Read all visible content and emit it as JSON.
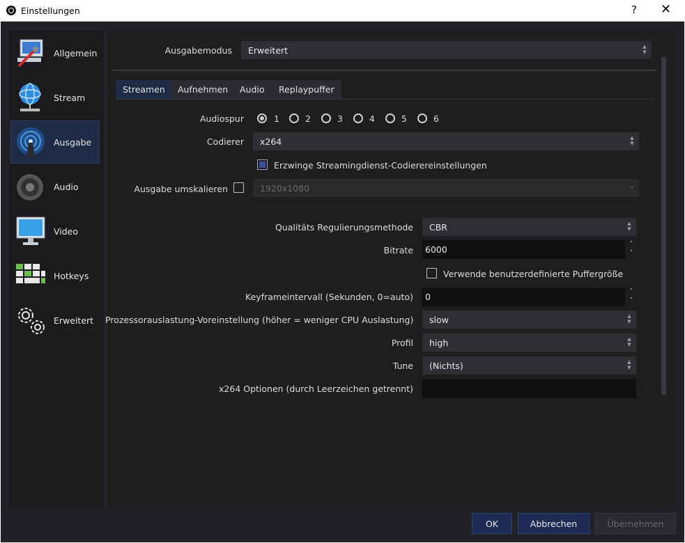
{
  "window": {
    "title": "Einstellungen",
    "help": "?",
    "close": "✕"
  },
  "sidebar": {
    "items": [
      {
        "label": "Allgemein"
      },
      {
        "label": "Stream"
      },
      {
        "label": "Ausgabe"
      },
      {
        "label": "Audio"
      },
      {
        "label": "Video"
      },
      {
        "label": "Hotkeys"
      },
      {
        "label": "Erweitert"
      }
    ],
    "active": "Ausgabe"
  },
  "output": {
    "mode_label": "Ausgabemodus",
    "mode_value": "Erweitert",
    "tabs": [
      "Streamen",
      "Aufnehmen",
      "Audio",
      "Replaypuffer"
    ],
    "active_tab": "Streamen",
    "audiospur_label": "Audiospur",
    "audio_tracks": [
      "1",
      "2",
      "3",
      "4",
      "5",
      "6"
    ],
    "selected_track": "1",
    "encoder_label": "Codierer",
    "encoder_value": "x264",
    "enforce_label": "Erzwinge Streamingdienst-Codierereinstellungen",
    "rescale_label": "Ausgabe umskalieren",
    "rescale_value": "1920x1080",
    "rate_control_label": "Qualitäts Regulierungsmethode",
    "rate_control_value": "CBR",
    "bitrate_label": "Bitrate",
    "bitrate_value": "6000",
    "custom_buffer_label": "Verwende benutzerdefinierte Puffergröße",
    "keyframe_label": "Keyframeintervall (Sekunden, 0=auto)",
    "keyframe_value": "0",
    "preset_label": "Prozessorauslastung-Voreinstellung (höher = weniger CPU Auslastung)",
    "preset_value": "slow",
    "profile_label": "Profil",
    "profile_value": "high",
    "tune_label": "Tune",
    "tune_value": "(Nichts)",
    "x264opts_label": "x264 Optionen (durch Leerzeichen getrennt)",
    "x264opts_value": ""
  },
  "buttons": {
    "ok": "OK",
    "cancel": "Abbrechen",
    "apply": "Übernehmen"
  },
  "colors": {
    "accent": "#1d2b45",
    "panel": "#1e1e21",
    "background": "#222226"
  }
}
